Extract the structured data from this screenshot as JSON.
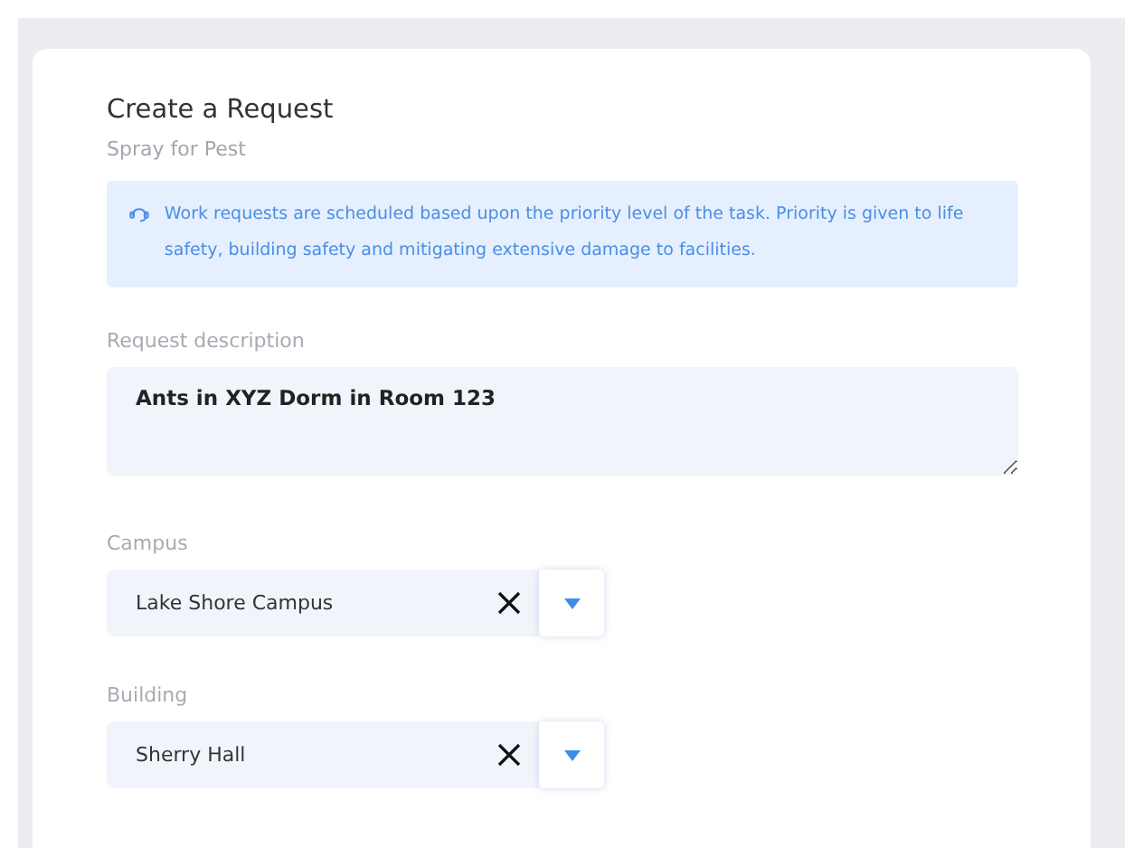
{
  "title": "Create a Request",
  "subtitle": "Spray for Pest",
  "notice": "Work requests are scheduled based upon the priority level of the task. Priority is given to life safety, building safety and mitigating extensive damage to facilities.",
  "description": {
    "label": "Request description",
    "value": "Ants in XYZ Dorm in Room 123"
  },
  "selects": [
    {
      "label": "Campus",
      "value": "Lake Shore Campus"
    },
    {
      "label": "Building",
      "value": "Sherry Hall"
    }
  ]
}
